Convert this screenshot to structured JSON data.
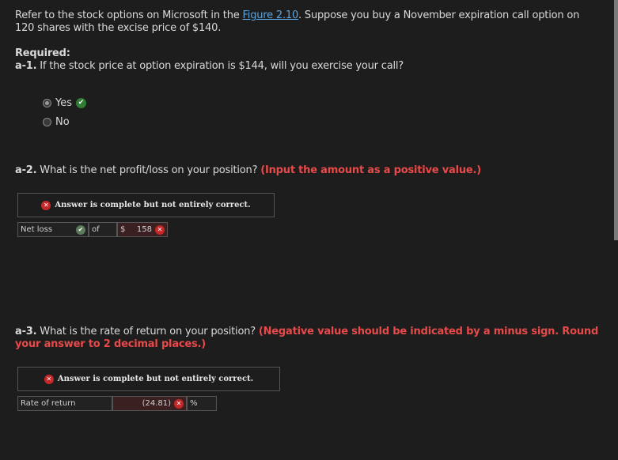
{
  "intro": {
    "before_link": "Refer to the stock options on Microsoft in the ",
    "link": "Figure 2.10",
    "after_link": ". Suppose you buy a November expiration call option on 120 shares with the excise price of $140."
  },
  "required_label": "Required:",
  "a1": {
    "label": "a-1.",
    "question": "If the stock price at option expiration is $144, will you exercise your call?",
    "options": [
      "Yes",
      "No"
    ],
    "selected": "Yes"
  },
  "a2": {
    "label": "a-2.",
    "question": "What is the net profit/loss on your position?",
    "instruction": "(Input the amount as a positive value.)",
    "status": "Answer is complete but not entirely correct.",
    "field_label": "Net loss",
    "of_text": "of",
    "currency": "$",
    "value": "158"
  },
  "a3": {
    "label": "a-3.",
    "question": "What is the rate of return on your position?",
    "instruction": "(Negative value should be indicated by a minus sign. Round your answer to 2 decimal places.)",
    "status": "Answer is complete but not entirely correct.",
    "field_label": "Rate of return",
    "value": "(24.81)",
    "unit": "%"
  },
  "colors": {
    "background": "#1d1d1d",
    "link": "#5ea4e0",
    "error": "#e84a4a",
    "correct": "#2e7d32"
  }
}
